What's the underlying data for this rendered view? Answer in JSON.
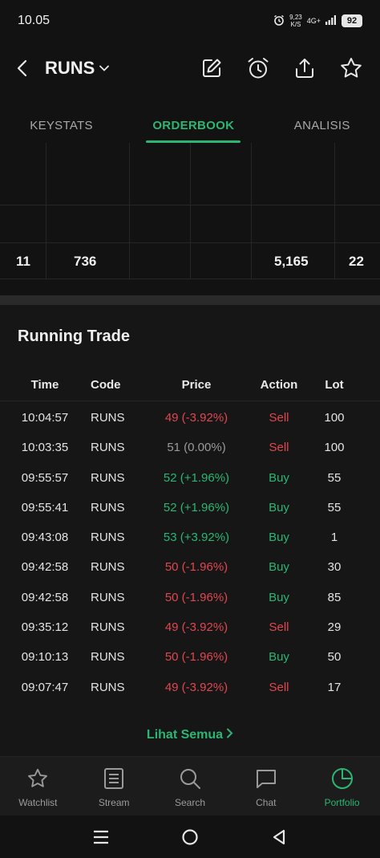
{
  "status_bar": {
    "time": "10.05",
    "net_speed_value": "9,23",
    "net_speed_unit": "K/S",
    "network": "4G+",
    "battery": "92"
  },
  "header": {
    "ticker": "RUNS",
    "icons": [
      "edit-icon",
      "alarm-icon",
      "share-icon",
      "star-icon"
    ]
  },
  "tabs": [
    {
      "label": "KEYSTATS",
      "active": false
    },
    {
      "label": "ORDERBOOK",
      "active": true
    },
    {
      "label": "ANALISIS",
      "active": false
    }
  ],
  "orderbook_totals": {
    "bid_freq": "11",
    "bid_lot": "736",
    "offer_lot": "5,165",
    "offer_freq": "22"
  },
  "running_trade": {
    "title": "Running Trade",
    "columns": {
      "time": "Time",
      "code": "Code",
      "price": "Price",
      "action": "Action",
      "lot": "Lot"
    },
    "rows": [
      {
        "time": "10:04:57",
        "code": "RUNS",
        "price": "49 (-3.92%)",
        "price_dir": "down",
        "action": "Sell",
        "lot": "100"
      },
      {
        "time": "10:03:35",
        "code": "RUNS",
        "price": "51 (0.00%)",
        "price_dir": "flat",
        "action": "Sell",
        "lot": "100"
      },
      {
        "time": "09:55:57",
        "code": "RUNS",
        "price": "52 (+1.96%)",
        "price_dir": "up",
        "action": "Buy",
        "lot": "55"
      },
      {
        "time": "09:55:41",
        "code": "RUNS",
        "price": "52 (+1.96%)",
        "price_dir": "up",
        "action": "Buy",
        "lot": "55"
      },
      {
        "time": "09:43:08",
        "code": "RUNS",
        "price": "53 (+3.92%)",
        "price_dir": "up",
        "action": "Buy",
        "lot": "1"
      },
      {
        "time": "09:42:58",
        "code": "RUNS",
        "price": "50 (-1.96%)",
        "price_dir": "down",
        "action": "Buy",
        "lot": "30"
      },
      {
        "time": "09:42:58",
        "code": "RUNS",
        "price": "50 (-1.96%)",
        "price_dir": "down",
        "action": "Buy",
        "lot": "85"
      },
      {
        "time": "09:35:12",
        "code": "RUNS",
        "price": "49 (-3.92%)",
        "price_dir": "down",
        "action": "Sell",
        "lot": "29"
      },
      {
        "time": "09:10:13",
        "code": "RUNS",
        "price": "50 (-1.96%)",
        "price_dir": "down",
        "action": "Buy",
        "lot": "50"
      },
      {
        "time": "09:07:47",
        "code": "RUNS",
        "price": "49 (-3.92%)",
        "price_dir": "down",
        "action": "Sell",
        "lot": "17"
      }
    ],
    "see_all": "Lihat Semua"
  },
  "bottom_nav": [
    {
      "label": "Watchlist",
      "icon": "star-outline-icon",
      "active": false
    },
    {
      "label": "Stream",
      "icon": "stream-icon",
      "active": false
    },
    {
      "label": "Search",
      "icon": "search-icon",
      "active": false
    },
    {
      "label": "Chat",
      "icon": "chat-icon",
      "active": false
    },
    {
      "label": "Portfolio",
      "icon": "portfolio-pie-icon",
      "active": true
    }
  ],
  "colors": {
    "accent_green": "#2bb673",
    "down_red": "#e0474f",
    "flat_grey": "#9a9a9a",
    "background": "#121212"
  }
}
